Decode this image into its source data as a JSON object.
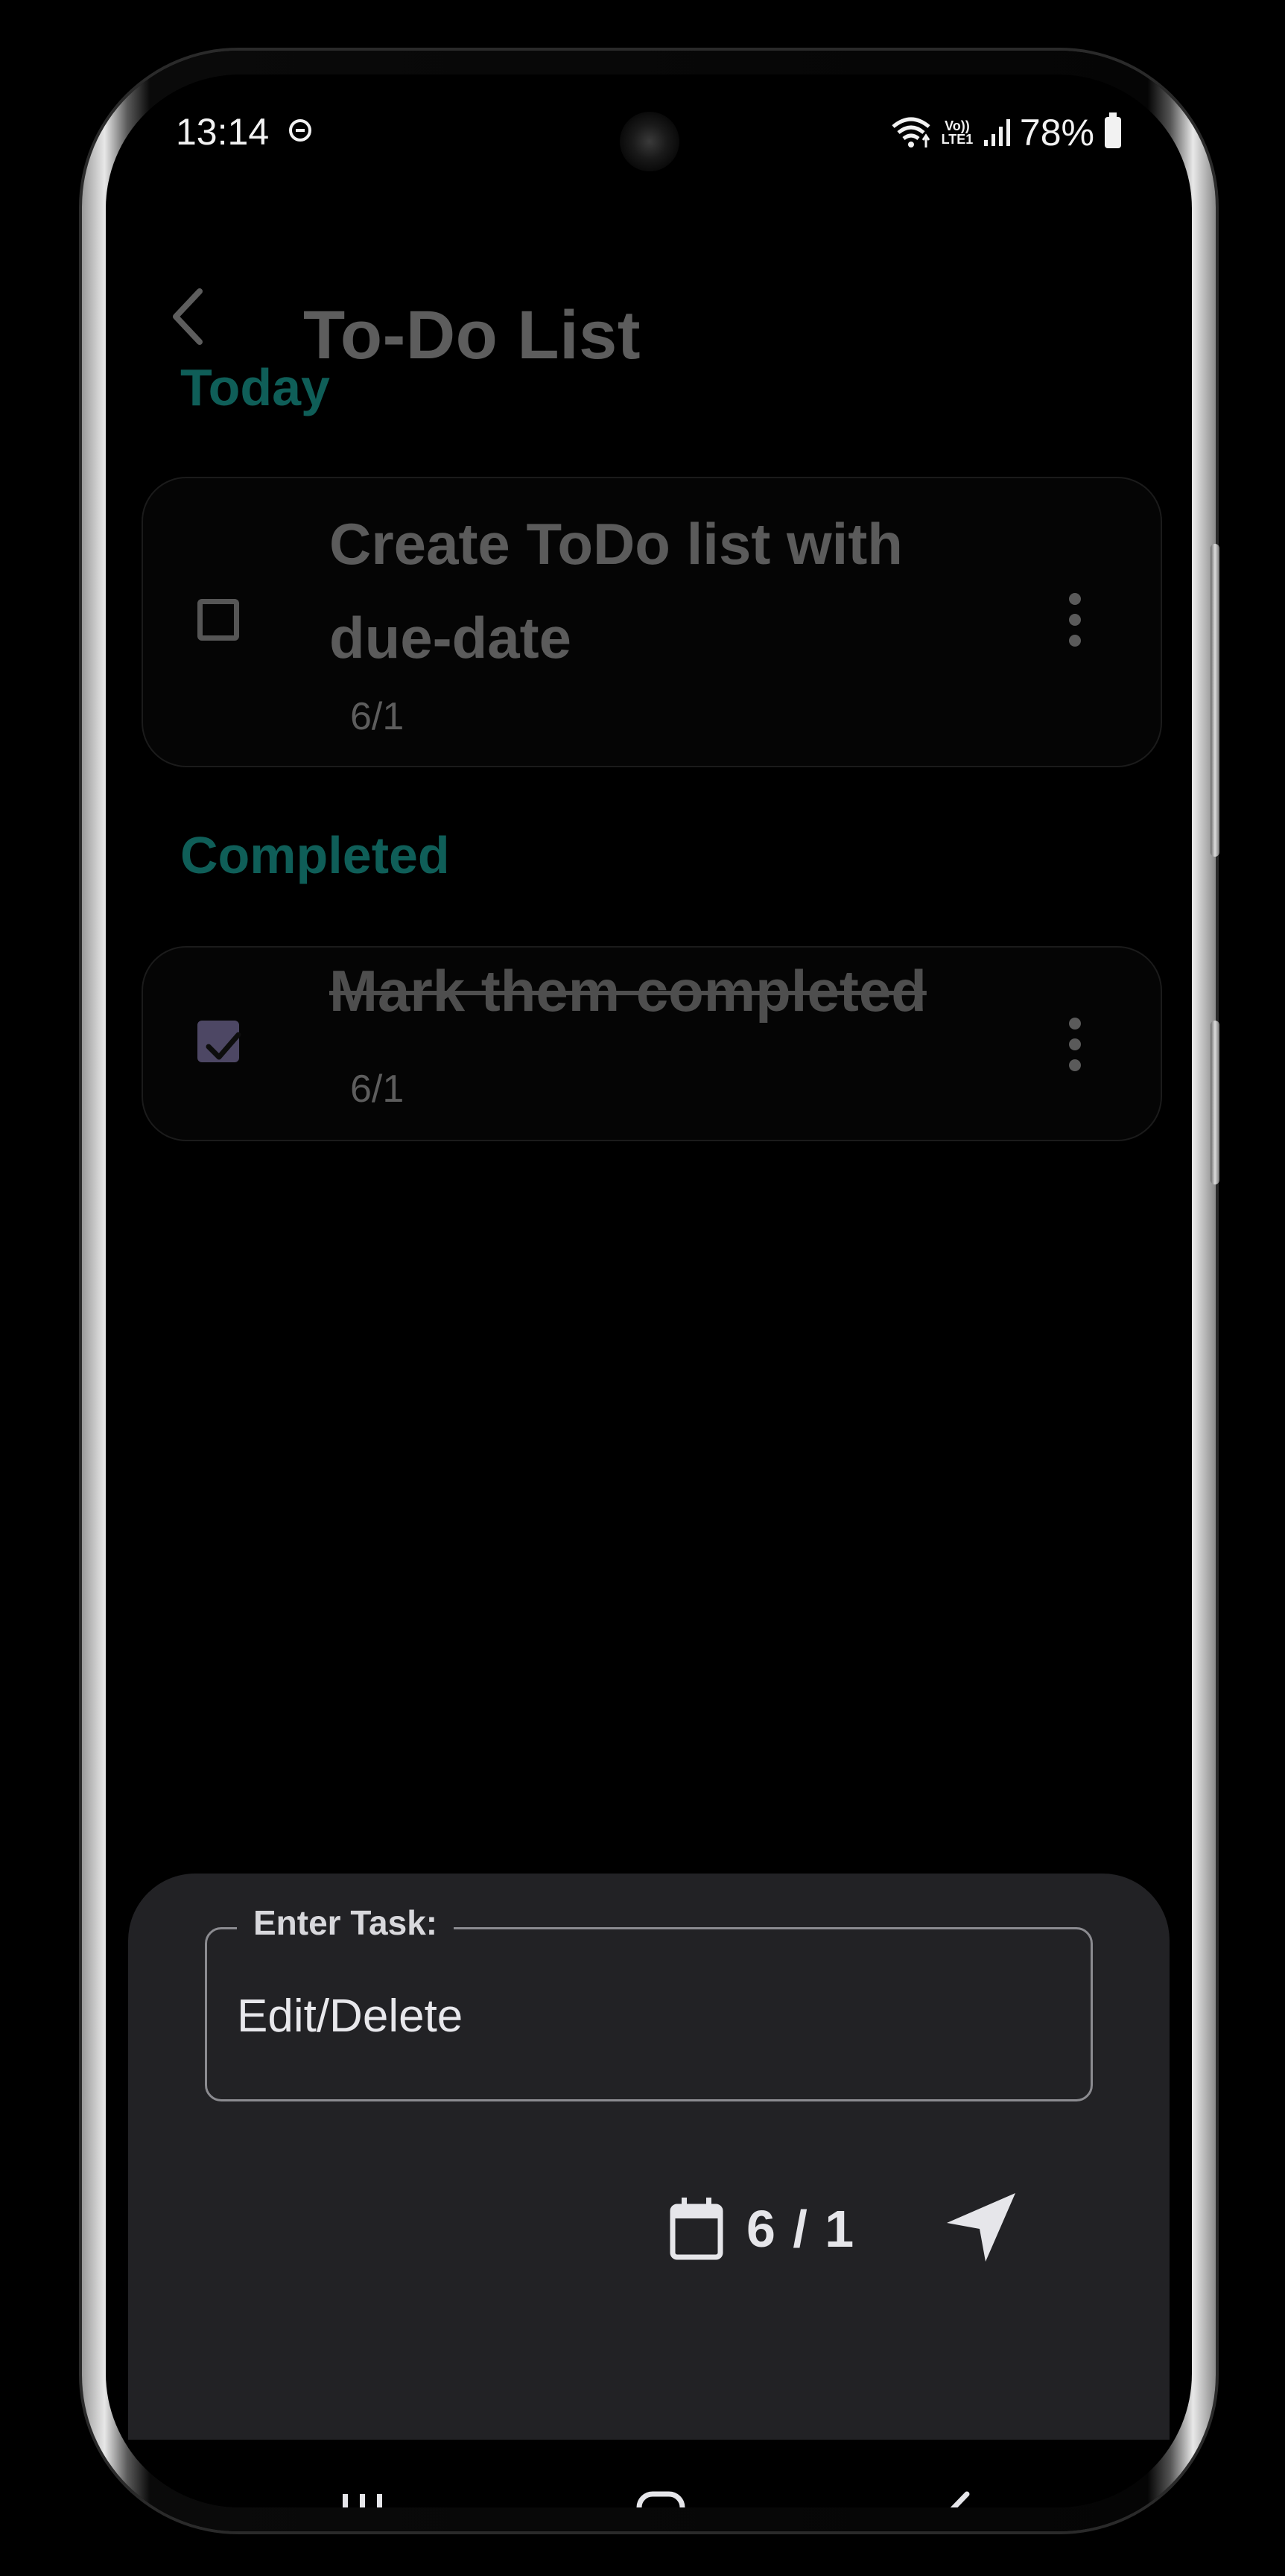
{
  "status_bar": {
    "time": "13:14",
    "volte": "Vo)) LTE1",
    "battery": "78%"
  },
  "header": {
    "title": "To-Do List"
  },
  "sections": {
    "today": {
      "label": "Today",
      "tasks": [
        {
          "title": "Create ToDo list with due-date",
          "date": "6/1",
          "completed": false
        }
      ]
    },
    "completed": {
      "label": "Completed",
      "tasks": [
        {
          "title": "Mark them completed",
          "date": "6/1",
          "completed": true
        }
      ]
    }
  },
  "composer": {
    "label": "Enter Task:",
    "value": "Edit/Delete",
    "date": "6 / 1"
  },
  "colors": {
    "section_accent": "#0f5e58",
    "checkbox_checked": "#4d4764",
    "sheet_background": "#222225"
  },
  "icons": {
    "back": "chevron-left-icon",
    "more": "more-vertical-icon",
    "calendar": "calendar-icon",
    "send": "send-icon"
  }
}
